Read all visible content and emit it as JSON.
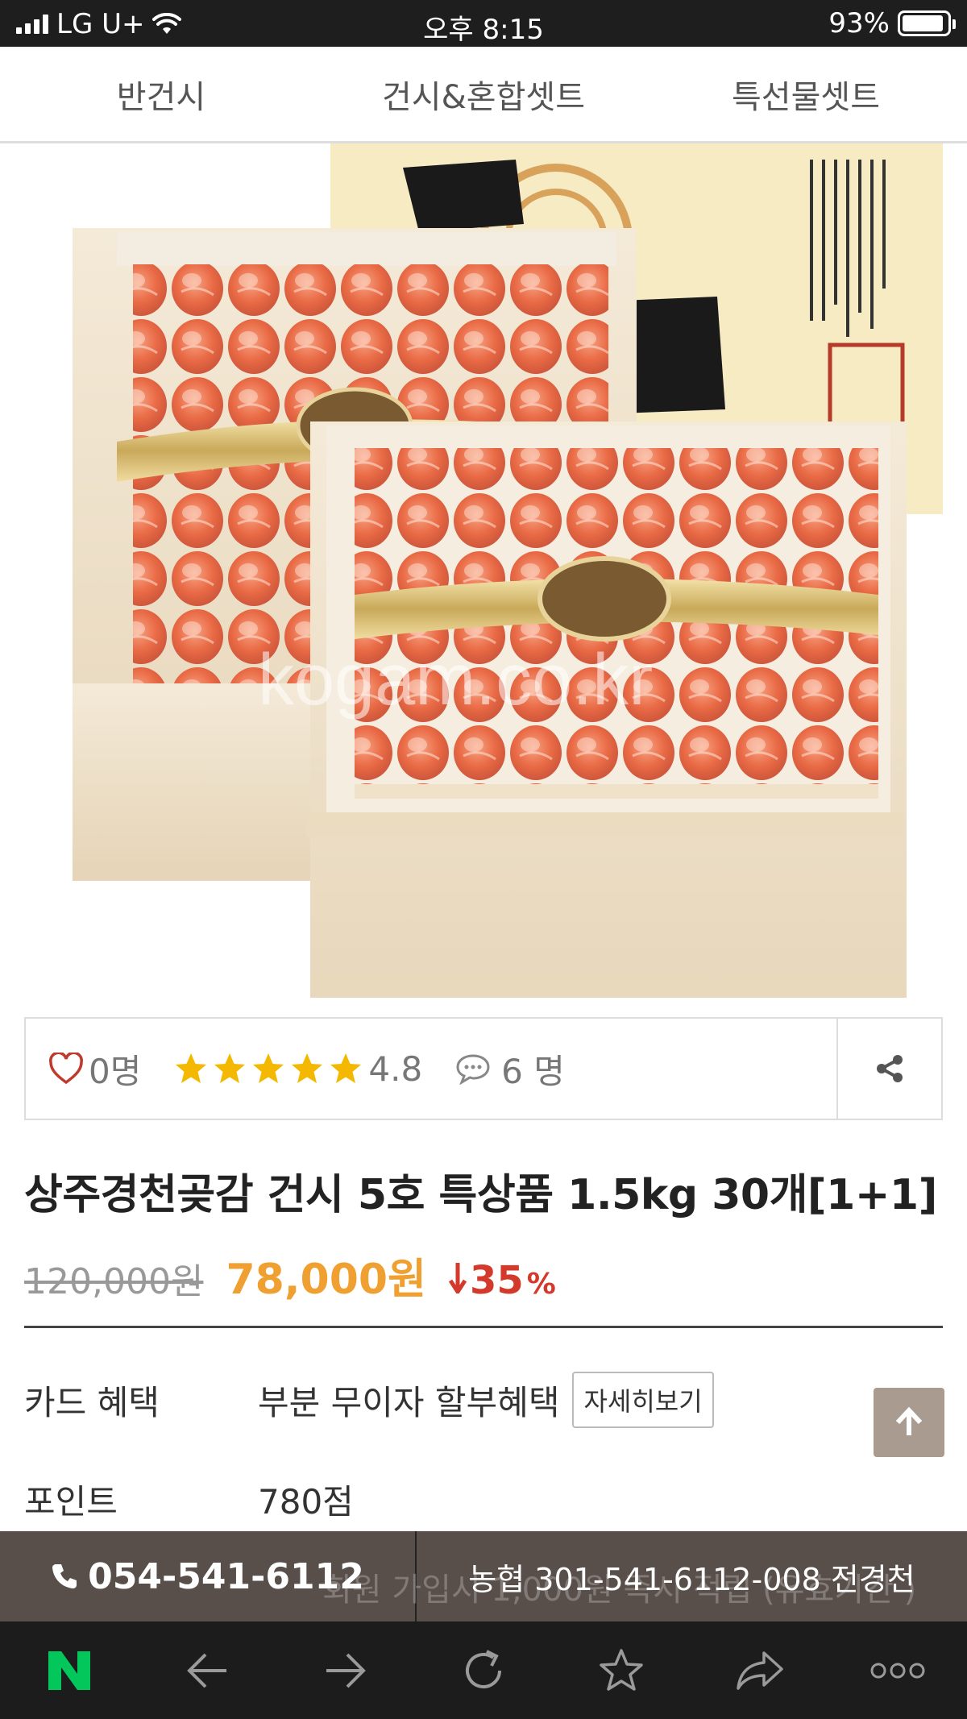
{
  "status_bar": {
    "carrier": "LG U+",
    "time": "오후 8:15",
    "battery_percent": "93%",
    "battery_level": 0.93
  },
  "tabs": [
    {
      "label": "반건시"
    },
    {
      "label": "건시&혼합셋트"
    },
    {
      "label": "특선물셋트"
    }
  ],
  "hero": {
    "watermark": "kogam.co.kr"
  },
  "stats": {
    "likes": "0명",
    "rating": "4.8",
    "star_count": 5,
    "comments": "6 명"
  },
  "product": {
    "title": "상주경천곶감 건시 5호 특상품 1.5kg 30개[1+1]",
    "original_price": "120,000원",
    "sale_price": "78,000원",
    "discount": "35",
    "discount_unit": "%"
  },
  "info": {
    "card_label": "카드 혜택",
    "card_value": "부분 무이자 할부혜택",
    "detail_button": "자세히보기",
    "point_label": "포인트",
    "point_value": "780점",
    "hidden_text": "회원 가입시 1,000원 즉시 적립 (유효기간 )"
  },
  "contact": {
    "phone": "054-541-6112",
    "bank": "농협 301-541-6112-008 전경천"
  },
  "browser_bar": {
    "logo": "N",
    "icons": [
      "back-icon",
      "forward-icon",
      "refresh-icon",
      "bookmark-star-icon",
      "share-arrow-icon",
      "more-icon"
    ]
  },
  "colors": {
    "sale_price": "#f0a030",
    "discount": "#d33a2c",
    "contact_bar": "#4b413c",
    "naver_green": "#03c75a",
    "star": "#f5b800"
  }
}
